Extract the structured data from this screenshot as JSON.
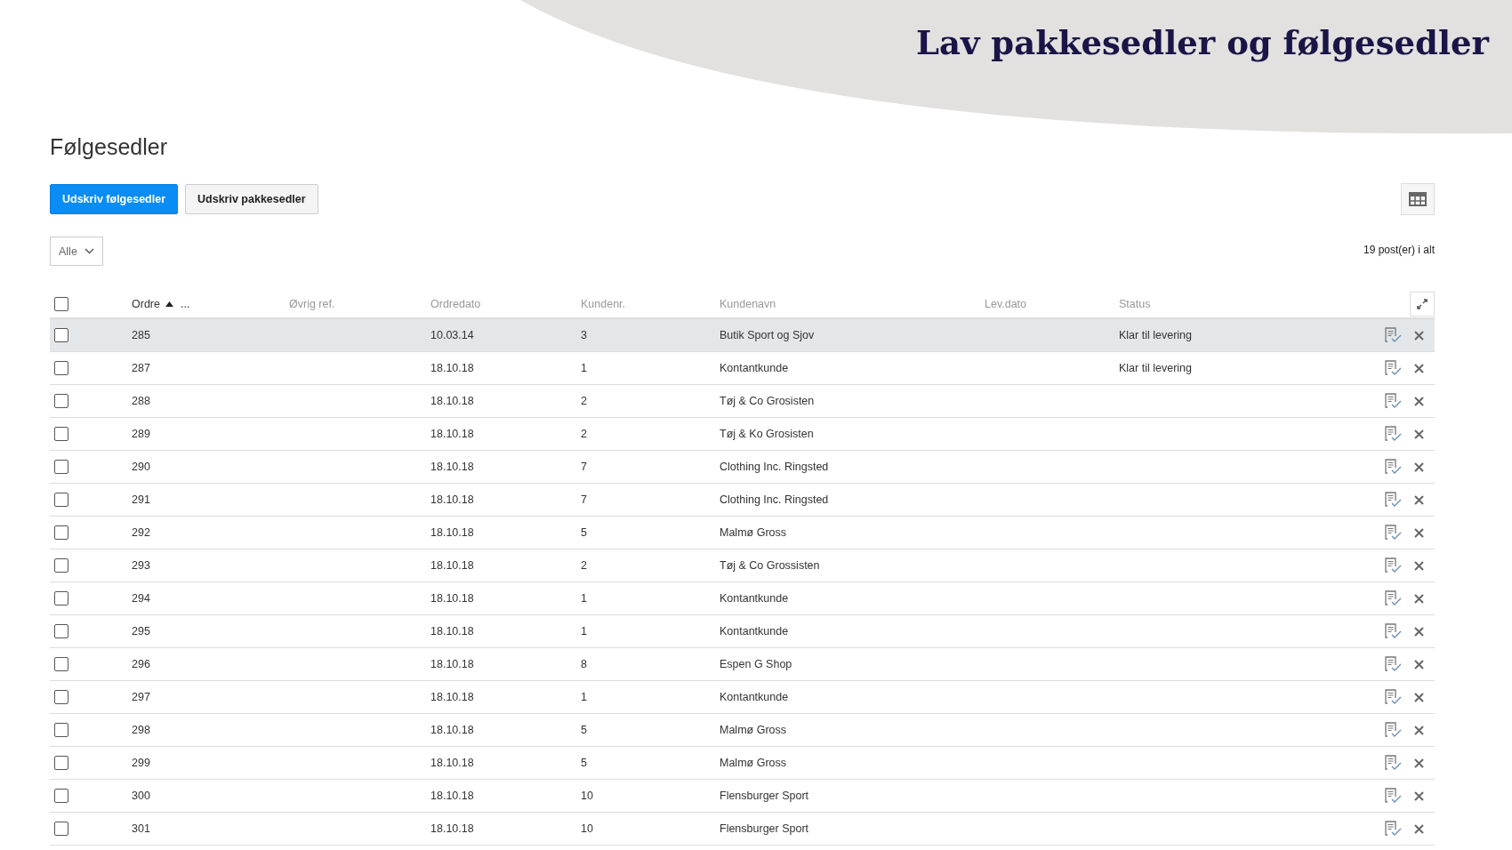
{
  "banner": {
    "title": "Lav pakkesedler og følgesedler"
  },
  "page": {
    "heading": "Følgesedler"
  },
  "buttons": [
    {
      "label": "Udskriv følgesedler",
      "kind": "primary"
    },
    {
      "label": "Udskriv pakkesedler",
      "kind": "secondary"
    }
  ],
  "filter": {
    "value": "Alle"
  },
  "record_count": "19 post(er) i alt",
  "table": {
    "select_all": {
      "checked": false
    },
    "columns": [
      {
        "label": "Ordre",
        "sorted": true,
        "extra": "..."
      },
      {
        "label": "Øvrig ref.",
        "sorted": false
      },
      {
        "label": "Ordredato",
        "sorted": false
      },
      {
        "label": "Kundenr.",
        "sorted": false
      },
      {
        "label": "Kundenavn",
        "sorted": false
      },
      {
        "label": "Lev.dato",
        "sorted": false
      },
      {
        "label": "Status",
        "sorted": false
      }
    ],
    "rows": [
      {
        "selected": true,
        "checked": false,
        "order": "285",
        "date": "10.03.14",
        "customer_no": "3",
        "customer_name": "Butik Sport og Sjov",
        "status": "Klar til levering"
      },
      {
        "selected": false,
        "checked": false,
        "order": "287",
        "date": "18.10.18",
        "customer_no": "1",
        "customer_name": "Kontantkunde",
        "status": "Klar til levering"
      },
      {
        "selected": false,
        "checked": false,
        "order": "288",
        "date": "18.10.18",
        "customer_no": "2",
        "customer_name": "Tøj & Co Grosisten"
      },
      {
        "selected": false,
        "checked": false,
        "order": "289",
        "date": "18.10.18",
        "customer_no": "2",
        "customer_name": "Tøj & Ko Grosisten"
      },
      {
        "selected": false,
        "checked": false,
        "order": "290",
        "date": "18.10.18",
        "customer_no": "7",
        "customer_name": "Clothing Inc. Ringsted"
      },
      {
        "selected": false,
        "checked": false,
        "order": "291",
        "date": "18.10.18",
        "customer_no": "7",
        "customer_name": "Clothing Inc. Ringsted"
      },
      {
        "selected": false,
        "checked": false,
        "order": "292",
        "date": "18.10.18",
        "customer_no": "5",
        "customer_name": "Malmø Gross"
      },
      {
        "selected": false,
        "checked": false,
        "order": "293",
        "date": "18.10.18",
        "customer_no": "2",
        "customer_name": "Tøj & Co Grossisten"
      },
      {
        "selected": false,
        "checked": false,
        "order": "294",
        "date": "18.10.18",
        "customer_no": "1",
        "customer_name": "Kontantkunde"
      },
      {
        "selected": false,
        "checked": false,
        "order": "295",
        "date": "18.10.18",
        "customer_no": "1",
        "customer_name": "Kontantkunde"
      },
      {
        "selected": false,
        "checked": false,
        "order": "296",
        "date": "18.10.18",
        "customer_no": "8",
        "customer_name": "Espen G Shop"
      },
      {
        "selected": false,
        "checked": false,
        "order": "297",
        "date": "18.10.18",
        "customer_no": "1",
        "customer_name": "Kontantkunde"
      },
      {
        "selected": false,
        "checked": false,
        "order": "298",
        "date": "18.10.18",
        "customer_no": "5",
        "customer_name": "Malmø Gross"
      },
      {
        "selected": false,
        "checked": false,
        "order": "299",
        "date": "18.10.18",
        "customer_no": "5",
        "customer_name": "Malmø Gross"
      },
      {
        "selected": false,
        "checked": false,
        "order": "300",
        "date": "18.10.18",
        "customer_no": "10",
        "customer_name": "Flensburger Sport"
      },
      {
        "selected": false,
        "checked": false,
        "order": "301",
        "date": "18.10.18",
        "customer_no": "10",
        "customer_name": "Flensburger Sport"
      }
    ]
  }
}
